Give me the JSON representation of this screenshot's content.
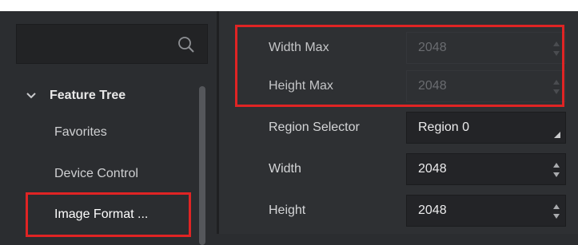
{
  "search": {
    "placeholder": ""
  },
  "sidebar": {
    "header": "Feature Tree",
    "items": [
      {
        "label": "Favorites"
      },
      {
        "label": "Device Control"
      },
      {
        "label": "Image Format ..."
      }
    ]
  },
  "features": [
    {
      "label": "Width Max",
      "value": "2048",
      "enabled": false
    },
    {
      "label": "Height Max",
      "value": "2048",
      "enabled": false
    },
    {
      "label": "Region Selector",
      "value": "Region 0",
      "type": "combo"
    },
    {
      "label": "Width",
      "value": "2048",
      "type": "spin"
    },
    {
      "label": "Height",
      "value": "2048",
      "type": "spin"
    }
  ],
  "colors": {
    "highlight": "#e02424",
    "background": "#2b2d30"
  },
  "icons": {
    "search": "search-icon",
    "collapse": "chevron-down-icon"
  }
}
